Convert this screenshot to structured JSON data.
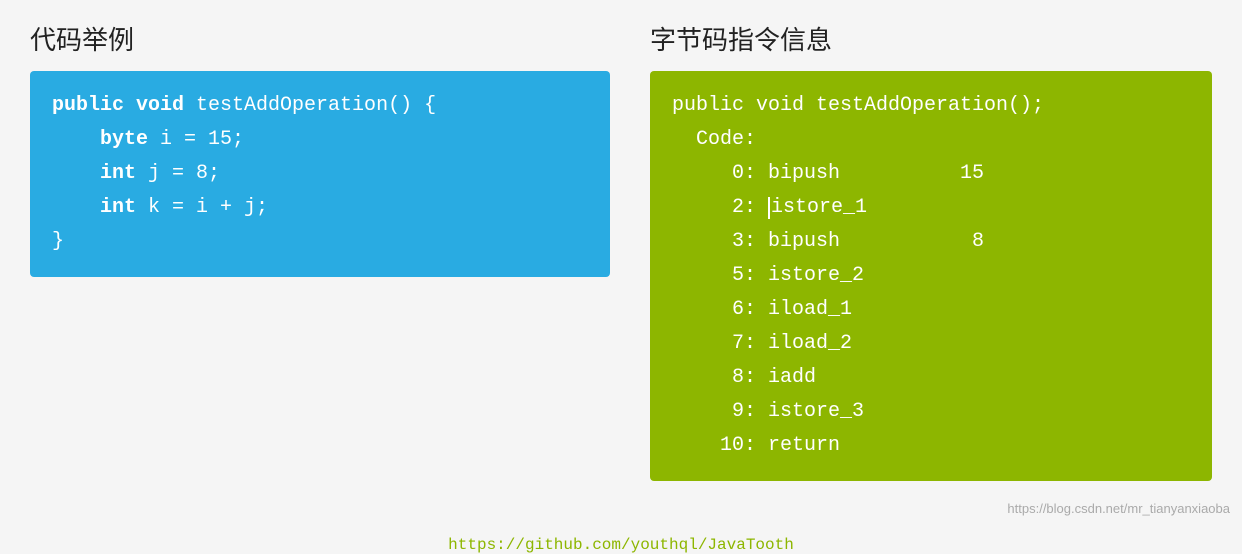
{
  "left": {
    "title": "代码举例",
    "code_lines": [
      {
        "type": "method_sig",
        "content": "public void testAddOperation() {",
        "keyword": "public void",
        "rest": " testAddOperation() {"
      },
      {
        "type": "var_byte",
        "keyword": "byte",
        "rest": " i = 15;"
      },
      {
        "type": "var_int1",
        "keyword": "int",
        "rest": " j = 8;"
      },
      {
        "type": "var_int2",
        "keyword": "int",
        "rest": " k = i + j;"
      },
      {
        "type": "close",
        "content": "}"
      }
    ]
  },
  "right": {
    "title": "字节码指令信息",
    "lines": [
      "public void testAddOperation();",
      "  Code:",
      "     0: bipush          15",
      "     2: istore_1",
      "     3: bipush           8",
      "     5: istore_2",
      "     6: iload_1",
      "     7: iload_2",
      "     8: iadd",
      "     9: istore_3",
      "    10: return"
    ]
  },
  "link": "https://github.com/youthql/JavaTooth",
  "watermark": "https://blog.csdn.net/mr_tianyanxiaoba"
}
